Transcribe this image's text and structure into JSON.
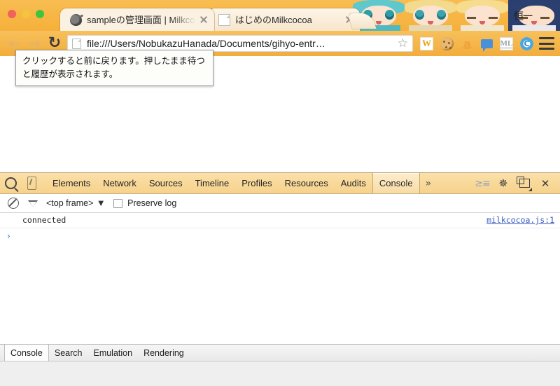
{
  "window": {
    "traffic_lights": [
      "close",
      "minimize",
      "zoom"
    ]
  },
  "theme": {
    "overlay_text": "恒一",
    "accent_orange": "#f5b03a",
    "toolbar_gradient_top": "#f8c05a",
    "toolbar_gradient_bottom": "#f2ad3d"
  },
  "tabs": [
    {
      "title": "sampleの管理画面 | Milkcoc",
      "favicon": "cocoa-bean-icon",
      "active": true,
      "close_label": "×"
    },
    {
      "title": "はじめのMilkcocoa",
      "favicon": "page-icon",
      "active": false,
      "close_label": "×"
    }
  ],
  "new_tab_button": {
    "label": "+"
  },
  "toolbar": {
    "back_label": "←",
    "forward_label": "→",
    "reload_label": "⟳",
    "url": "file:///Users/NobukazuHanada/Documents/gihyo-entr…",
    "star_label": "☆",
    "extensions": [
      {
        "name": "w-extension-icon",
        "label": "W"
      },
      {
        "name": "cookie-extension-icon",
        "label": ""
      },
      {
        "name": "amazon-extension-icon",
        "label": "a"
      },
      {
        "name": "chat-extension-icon",
        "label": ""
      },
      {
        "name": "ml-extension-icon",
        "label": "ML"
      },
      {
        "name": "c-extension-icon",
        "label": "C"
      }
    ],
    "menu_label": "≡"
  },
  "tooltip": {
    "text": "クリックすると前に戻ります。押したまま待つと履歴が表示されます。"
  },
  "devtools": {
    "inspect_icon": "magnifier-icon",
    "device_icon": "device-toggle-icon",
    "tabs": [
      {
        "label": "Elements",
        "selected": false
      },
      {
        "label": "Network",
        "selected": false
      },
      {
        "label": "Sources",
        "selected": false
      },
      {
        "label": "Timeline",
        "selected": false
      },
      {
        "label": "Profiles",
        "selected": false
      },
      {
        "label": "Resources",
        "selected": false
      },
      {
        "label": "Audits",
        "selected": false
      },
      {
        "label": "Console",
        "selected": true
      }
    ],
    "more_label": "»",
    "right_buttons": [
      {
        "name": "show-drawer-icon",
        "label": "≥"
      },
      {
        "name": "gear-icon",
        "label": "✻"
      },
      {
        "name": "dock-side-icon",
        "label": ""
      },
      {
        "name": "close-devtools-icon",
        "label": "×"
      }
    ],
    "filterbar": {
      "clear_icon": "clear-console-icon",
      "filter_icon": "filter-funnel-icon",
      "frame_selector": "<top frame>",
      "frame_caret": "▼",
      "preserve_log_label": "Preserve log",
      "preserve_log_checked": false
    },
    "console_rows": [
      {
        "message": "connected",
        "source": "milkcocoa.js:1"
      }
    ],
    "prompt_caret": "›",
    "prompt_value": ""
  },
  "drawer": {
    "tabs": [
      {
        "label": "Console",
        "selected": true
      },
      {
        "label": "Search",
        "selected": false
      },
      {
        "label": "Emulation",
        "selected": false
      },
      {
        "label": "Rendering",
        "selected": false
      }
    ]
  }
}
